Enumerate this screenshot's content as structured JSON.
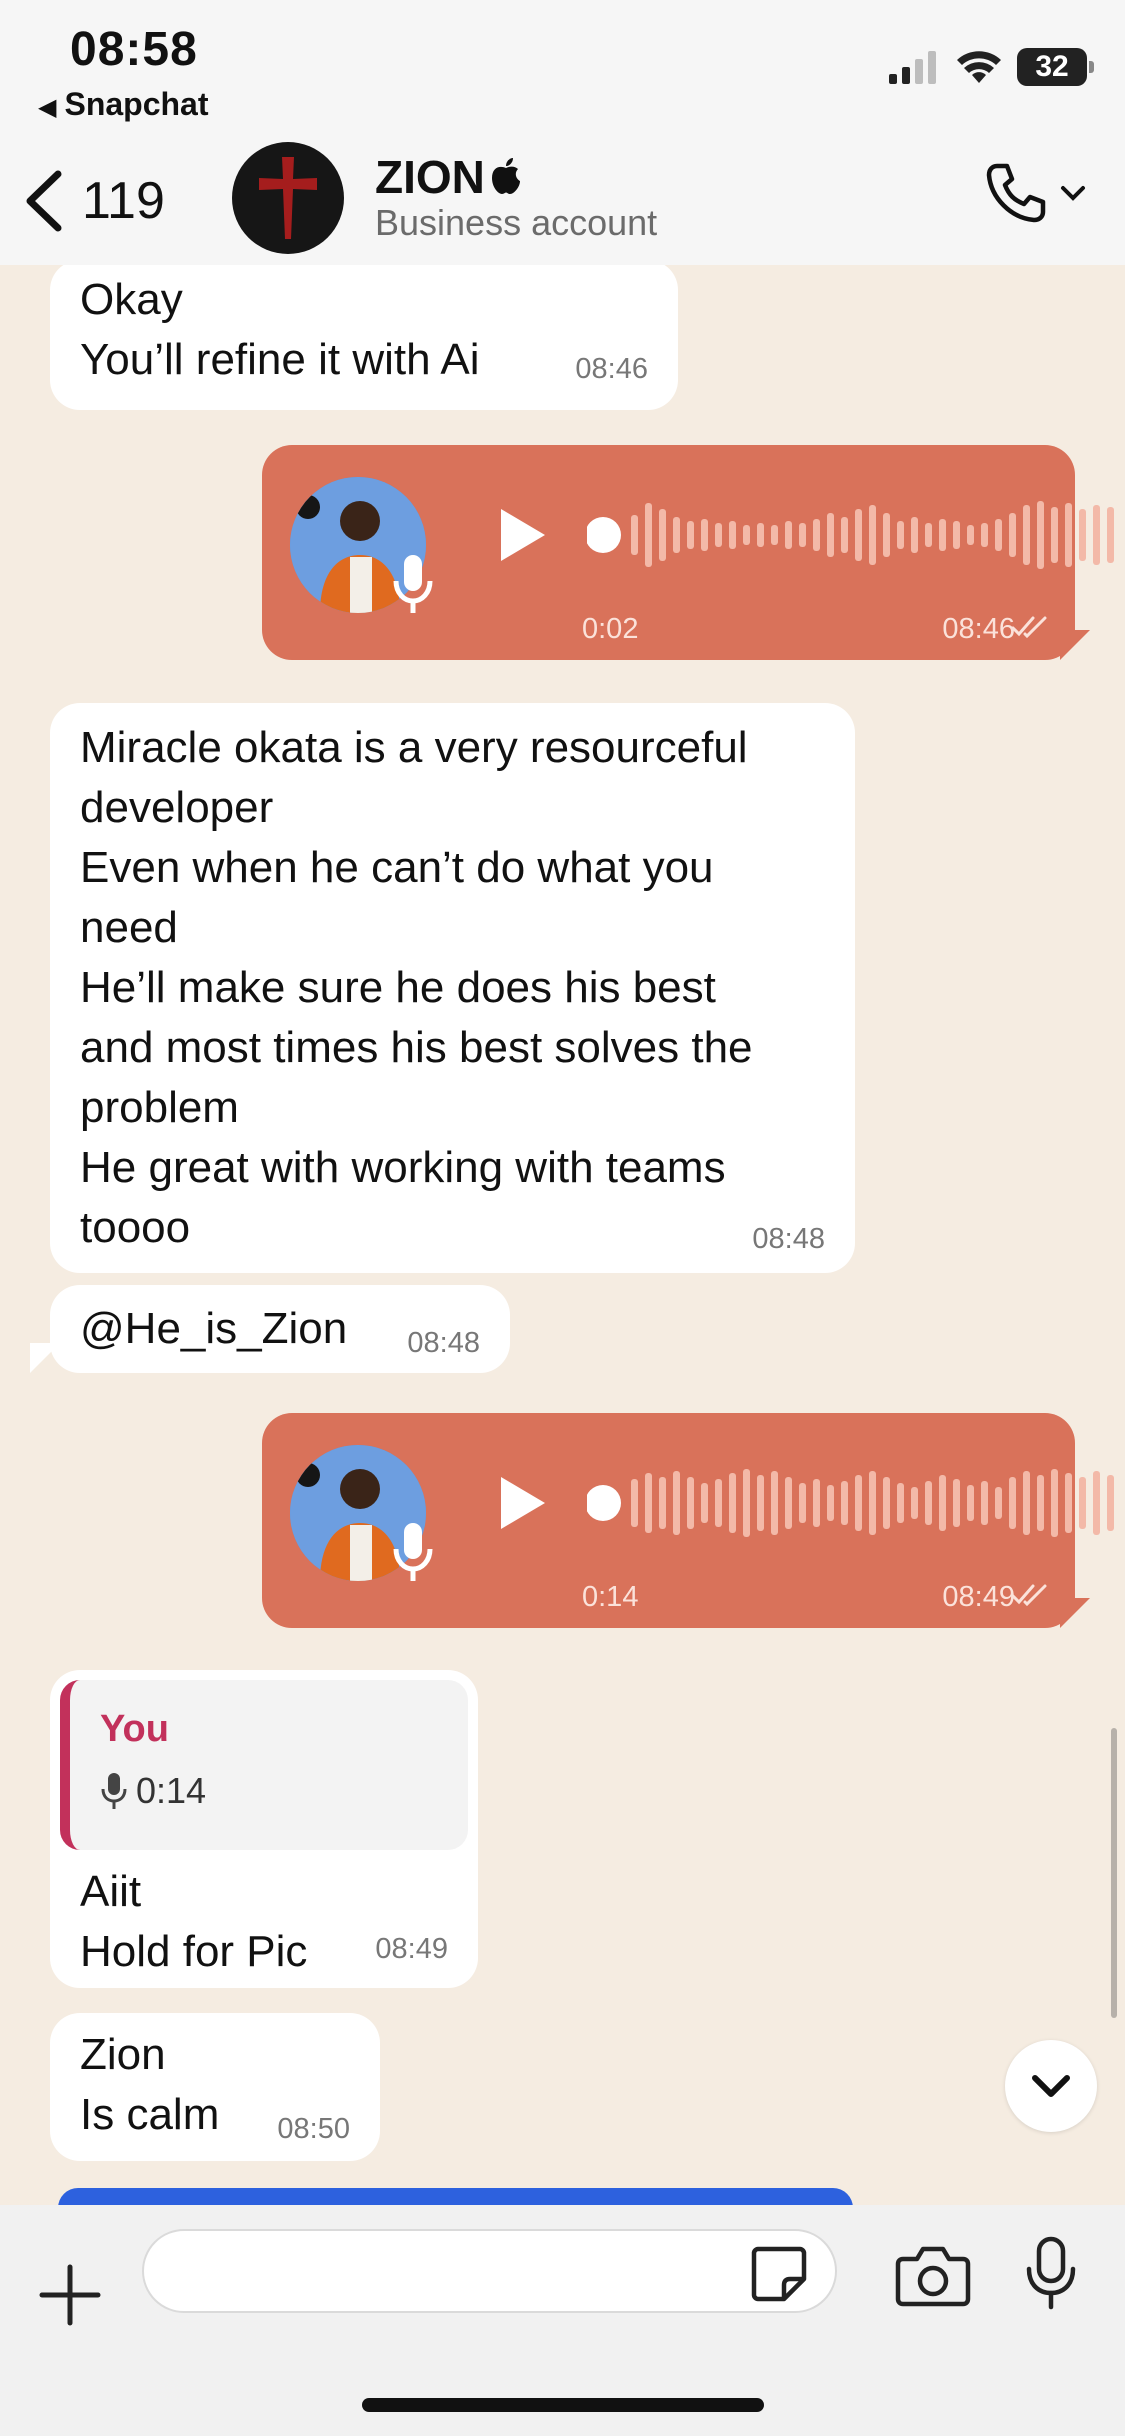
{
  "status_bar": {
    "time": "08:58",
    "back_app": "Snapchat",
    "battery": "32"
  },
  "header": {
    "unread_count": "119",
    "contact_name": "ZION",
    "contact_sub": "Business account"
  },
  "messages": [
    {
      "text": "Okay\nYou’ll refine it with Ai",
      "time": "08:46"
    },
    {
      "type": "voice",
      "duration": "0:02",
      "time": "08:46"
    },
    {
      "text": "Miracle okata is a very resourceful\ndeveloper\nEven when he can’t do what you\nneed\nHe’ll make sure he does his best\nand most times his best solves the\nproblem\nHe great with working with teams\ntoooo",
      "time": "08:48"
    },
    {
      "text": "@He_is_Zion",
      "time": "08:48"
    },
    {
      "type": "voice",
      "duration": "0:14",
      "time": "08:49"
    },
    {
      "reply_author": "You",
      "reply_duration": "0:14",
      "text": "Aiit\nHold for Pic",
      "time": "08:49"
    },
    {
      "text": "Zion\nIs calm",
      "time": "08:50"
    }
  ],
  "colors": {
    "chat_bg": "#f5ece1",
    "outgoing_bubble": "#d9725a",
    "incoming_bubble": "#ffffff",
    "reply_accent": "#c2315b"
  },
  "icons": [
    "back-chevron-icon",
    "cross-avatar-icon",
    "phone-icon",
    "play-icon",
    "mic-icon",
    "double-check-icon",
    "plus-icon",
    "sticker-icon",
    "camera-icon",
    "scroll-down-icon"
  ]
}
